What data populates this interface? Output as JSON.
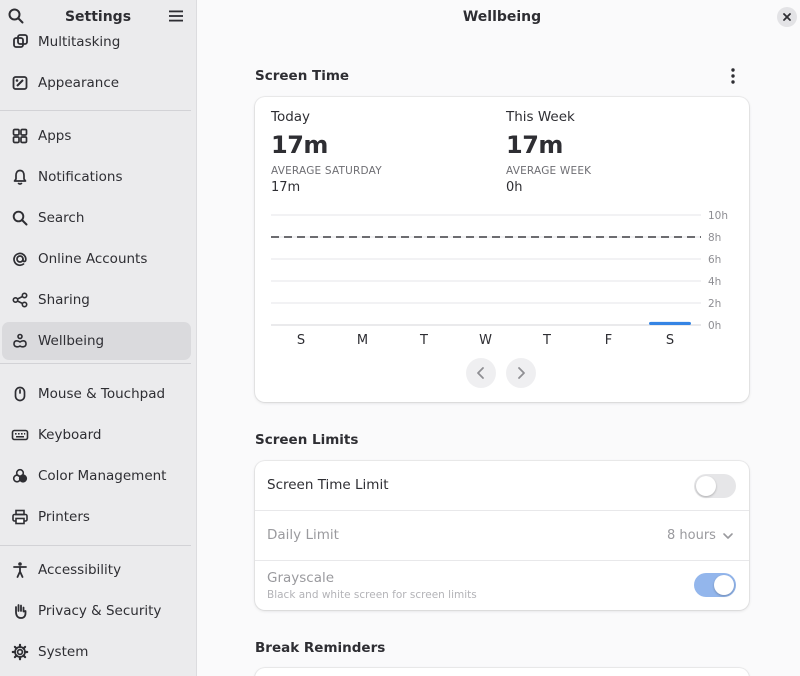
{
  "sidebar": {
    "title": "Settings",
    "items": [
      {
        "label": "Multitasking",
        "icon": "multitasking-icon"
      },
      {
        "label": "Appearance",
        "icon": "appearance-icon"
      },
      {
        "label": "Apps",
        "icon": "apps-icon"
      },
      {
        "label": "Notifications",
        "icon": "bell-icon"
      },
      {
        "label": "Search",
        "icon": "search-icon"
      },
      {
        "label": "Online Accounts",
        "icon": "at-icon"
      },
      {
        "label": "Sharing",
        "icon": "share-icon"
      },
      {
        "label": "Wellbeing",
        "icon": "wellbeing-icon",
        "active": true
      },
      {
        "label": "Mouse & Touchpad",
        "icon": "mouse-icon"
      },
      {
        "label": "Keyboard",
        "icon": "keyboard-icon"
      },
      {
        "label": "Color Management",
        "icon": "color-icon"
      },
      {
        "label": "Printers",
        "icon": "printer-icon"
      },
      {
        "label": "Accessibility",
        "icon": "accessibility-icon"
      },
      {
        "label": "Privacy & Security",
        "icon": "hand-icon"
      },
      {
        "label": "System",
        "icon": "gear-icon"
      }
    ]
  },
  "main": {
    "title": "Wellbeing",
    "screen_time": {
      "title": "Screen Time",
      "today": {
        "label": "Today",
        "value": "17m",
        "avg_caption": "AVERAGE SATURDAY",
        "avg_value": "17m"
      },
      "week": {
        "label": "This Week",
        "value": "17m",
        "avg_caption": "AVERAGE WEEK",
        "avg_value": "0h"
      }
    },
    "screen_limits": {
      "title": "Screen Limits",
      "time_limit": {
        "label": "Screen Time Limit",
        "enabled": false
      },
      "daily_limit": {
        "label": "Daily Limit",
        "value": "8 hours"
      },
      "grayscale": {
        "label": "Grayscale",
        "subtitle": "Black and white screen for screen limits",
        "enabled": true
      }
    },
    "break_reminders": {
      "title": "Break Reminders"
    }
  },
  "chart_data": {
    "type": "bar",
    "categories": [
      "S",
      "M",
      "T",
      "W",
      "T",
      "F",
      "S"
    ],
    "values": [
      0,
      0,
      0,
      0,
      0,
      0,
      0.28
    ],
    "y_ticks": [
      "0h",
      "2h",
      "4h",
      "6h",
      "8h",
      "10h"
    ],
    "ylim": [
      0,
      10
    ],
    "limit_line": 8,
    "bar_color": "#3584e4",
    "grid": true
  }
}
